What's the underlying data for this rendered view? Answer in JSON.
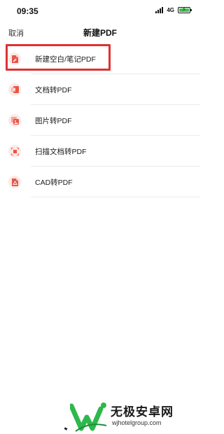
{
  "status_bar": {
    "time": "09:35",
    "network": "4G",
    "battery_level": 1.0,
    "battery_color": "#3dc24f"
  },
  "nav": {
    "cancel_label": "取消",
    "title": "新建PDF"
  },
  "menu": {
    "items": [
      {
        "label": "新建空白/笔记PDF",
        "icon": "blank-note-pdf-icon"
      },
      {
        "label": "文档转PDF",
        "icon": "document-pdf-icon"
      },
      {
        "label": "图片转PDF",
        "icon": "image-pdf-icon"
      },
      {
        "label": "扫描文档转PDF",
        "icon": "scan-document-pdf-icon"
      },
      {
        "label": "CAD转PDF",
        "icon": "cad-pdf-icon"
      }
    ]
  },
  "watermark": {
    "title": "无极安卓网",
    "url": "wjhotelgroup.com"
  },
  "colors": {
    "accent": "#e8564a",
    "icon_bg": "#fde9e6",
    "highlight": "#e03131"
  }
}
